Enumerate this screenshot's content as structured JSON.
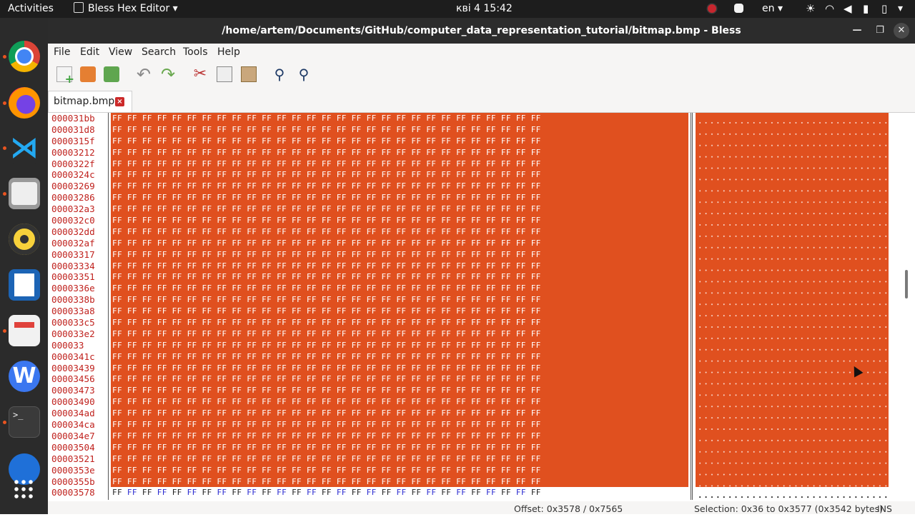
{
  "topbar": {
    "activities": "Activities",
    "app_name": "Bless Hex Editor",
    "clock": "кві 4  15:42",
    "language": "en",
    "icons": [
      "record-icon",
      "chat-icon",
      "brightness-icon",
      "wifi-icon",
      "volume-icon",
      "microphone-icon",
      "battery-icon",
      "power-icon"
    ]
  },
  "dock": {
    "apps": [
      "chrome",
      "firefox",
      "vscode",
      "files",
      "rhythmbox",
      "writer",
      "document-viewer",
      "wps-office",
      "terminal",
      "app-grid"
    ]
  },
  "window": {
    "title": "/home/artem/Documents/GitHub/computer_data_representation_tutorial/bitmap.bmp - Bless"
  },
  "menubar": {
    "items": [
      "File",
      "Edit",
      "View",
      "Search",
      "Tools",
      "Help"
    ]
  },
  "toolbar": {
    "buttons": [
      "new-file",
      "open-file",
      "save-file",
      "undo",
      "redo",
      "cut",
      "copy",
      "paste",
      "find",
      "find-replace"
    ]
  },
  "tab": {
    "label": "bitmap.bmp"
  },
  "hex": {
    "offsets": [
      "000031bb",
      "000031d8",
      "0000315f",
      "00003212",
      "0000322f",
      "0000324c",
      "00003269",
      "00003286",
      "000032a3",
      "000032c0",
      "000032dd",
      "000032af",
      "00003317",
      "00003334",
      "00003351",
      "0000336e",
      "0000338b",
      "000033a8",
      "000033c5",
      "000033e2",
      "000033",
      "0000341c",
      "00003439",
      "00003456",
      "00003473",
      "00003490",
      "000034ad",
      "000034ca",
      "000034e7",
      "00003504",
      "00003521",
      "0000353e",
      "0000355b",
      "00003578"
    ],
    "row_text": "FF FF FF FF FF FF FF FF FF FF FF FF FF FF FF FF FF FF FF FF FF FF FF FF FF FF FF FF FF"
  },
  "statusbar": {
    "offset": "Offset: 0x3578 / 0x7565",
    "selection": "Selection: 0x36 to 0x3577 (0x3542 bytes)",
    "mode": "INS"
  },
  "colors": {
    "selection": "#e0501f",
    "offset_text": "#c0221e",
    "alt_byte": "#2a2ad0"
  }
}
